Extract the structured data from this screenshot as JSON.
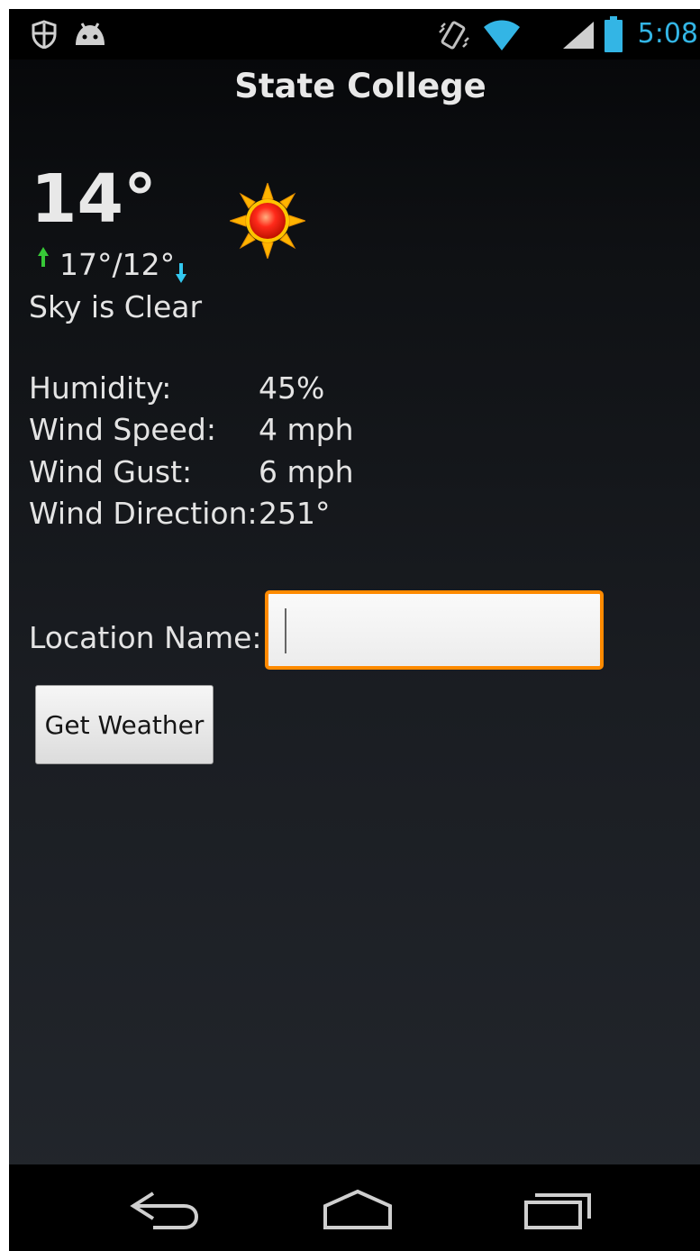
{
  "status_bar": {
    "time": "5:08",
    "left_icons": [
      "shield-icon",
      "android-debug-icon"
    ],
    "right_icons": [
      "vibrate-icon",
      "wifi-icon",
      "cell-signal-icon",
      "battery-icon"
    ],
    "accent_color": "#33b5e5"
  },
  "app": {
    "title": "State College"
  },
  "weather": {
    "temperature": "14°",
    "high_low": "17°/12°",
    "condition_icon": "sun-icon",
    "description": "Sky is Clear"
  },
  "details": [
    {
      "label": "Humidity:",
      "value": "45%"
    },
    {
      "label": "Wind Speed:",
      "value": "4 mph"
    },
    {
      "label": "Wind Gust:",
      "value": "6 mph"
    },
    {
      "label": "Wind Direction:",
      "value": "251°"
    }
  ],
  "form": {
    "location_label": "Location Name:",
    "location_value": "",
    "focus_color": "#ff8a00",
    "button_label": "Get Weather"
  },
  "nav_bar": {
    "buttons": [
      "back-icon",
      "home-icon",
      "recent-apps-icon"
    ]
  }
}
